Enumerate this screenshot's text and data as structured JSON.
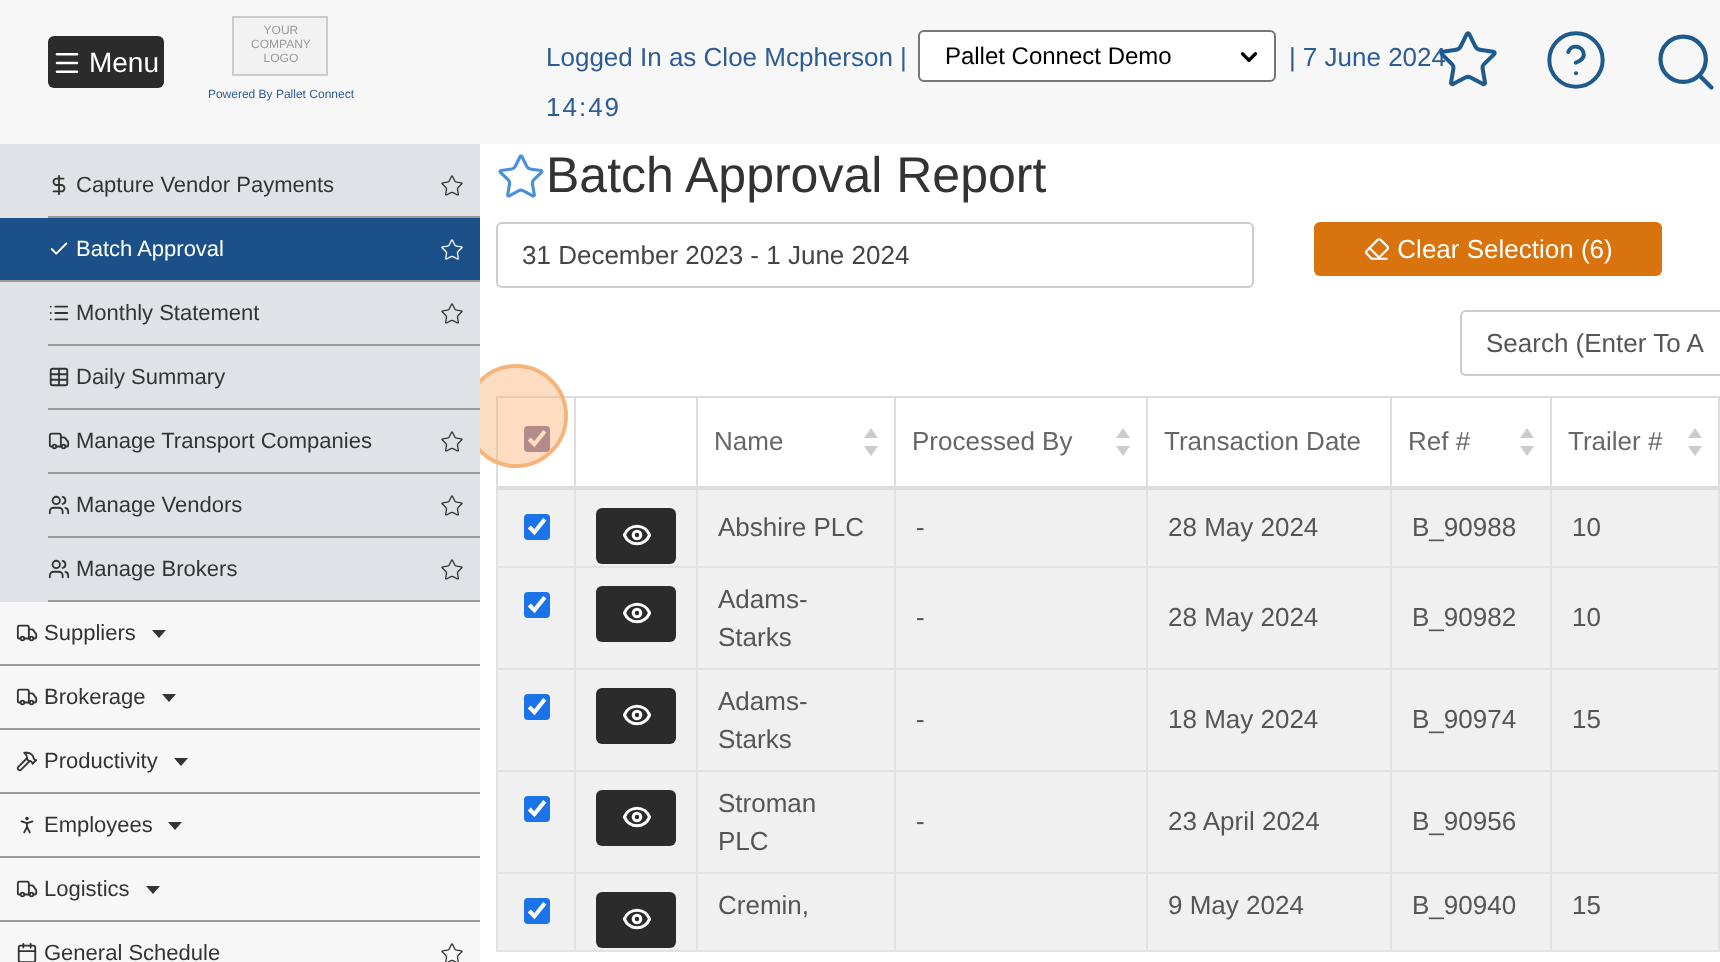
{
  "header": {
    "menu_button": "Menu",
    "logo_lines": [
      "YOUR",
      "COMPANY",
      "LOGO"
    ],
    "powered_by": "Powered By Pallet Connect",
    "logged_in": "Logged In as Cloe Mcpherson |",
    "company_select": "Pallet Connect Demo",
    "date": "| 7 June 2024",
    "time": "14:49"
  },
  "sidebar": {
    "sub_items": [
      {
        "label": "Capture Vendor Payments",
        "selected": false,
        "star": true
      },
      {
        "label": "Batch Approval",
        "selected": true,
        "star": true
      },
      {
        "label": "Monthly Statement",
        "selected": false,
        "star": true
      },
      {
        "label": "Daily Summary",
        "selected": false,
        "star": false
      },
      {
        "label": "Manage Transport Companies",
        "selected": false,
        "star": true
      },
      {
        "label": "Manage Vendors",
        "selected": false,
        "star": true
      },
      {
        "label": "Manage Brokers",
        "selected": false,
        "star": true
      }
    ],
    "groups": [
      {
        "label": "Suppliers",
        "caret": true,
        "star": false
      },
      {
        "label": "Brokerage",
        "caret": true,
        "star": false
      },
      {
        "label": "Productivity",
        "caret": true,
        "star": false
      },
      {
        "label": "Employees",
        "caret": true,
        "star": false
      },
      {
        "label": "Logistics",
        "caret": true,
        "star": false
      },
      {
        "label": "General Schedule",
        "caret": false,
        "star": true
      }
    ]
  },
  "page": {
    "title": "Batch Approval Report",
    "date_range": "31 December 2023 - 1 June 2024",
    "clear_button": "Clear Selection (6)",
    "search_placeholder": "Search (Enter To A"
  },
  "table": {
    "select_all_checked": true,
    "columns": [
      {
        "label": "Name",
        "sortable": true
      },
      {
        "label": "Processed By",
        "sortable": true
      },
      {
        "label": "Transaction Date",
        "sortable": false
      },
      {
        "label": "Ref #",
        "sortable": true
      },
      {
        "label": "Trailer #",
        "sortable": true
      }
    ],
    "rows": [
      {
        "checked": true,
        "cells": [
          "Abshire PLC",
          "-",
          "28 May 2024",
          "B_90988",
          "10"
        ]
      },
      {
        "checked": true,
        "cells": [
          "Adams-Starks",
          "-",
          "28 May 2024",
          "B_90982",
          "10"
        ]
      },
      {
        "checked": true,
        "cells": [
          "Adams-Starks",
          "-",
          "18 May 2024",
          "B_90974",
          "15"
        ]
      },
      {
        "checked": true,
        "cells": [
          "Stroman PLC",
          "-",
          "23 April 2024",
          "B_90956",
          ""
        ]
      },
      {
        "checked": true,
        "cells": [
          "Cremin,",
          "",
          "9 May 2024",
          "B_90940",
          "15"
        ]
      }
    ]
  }
}
